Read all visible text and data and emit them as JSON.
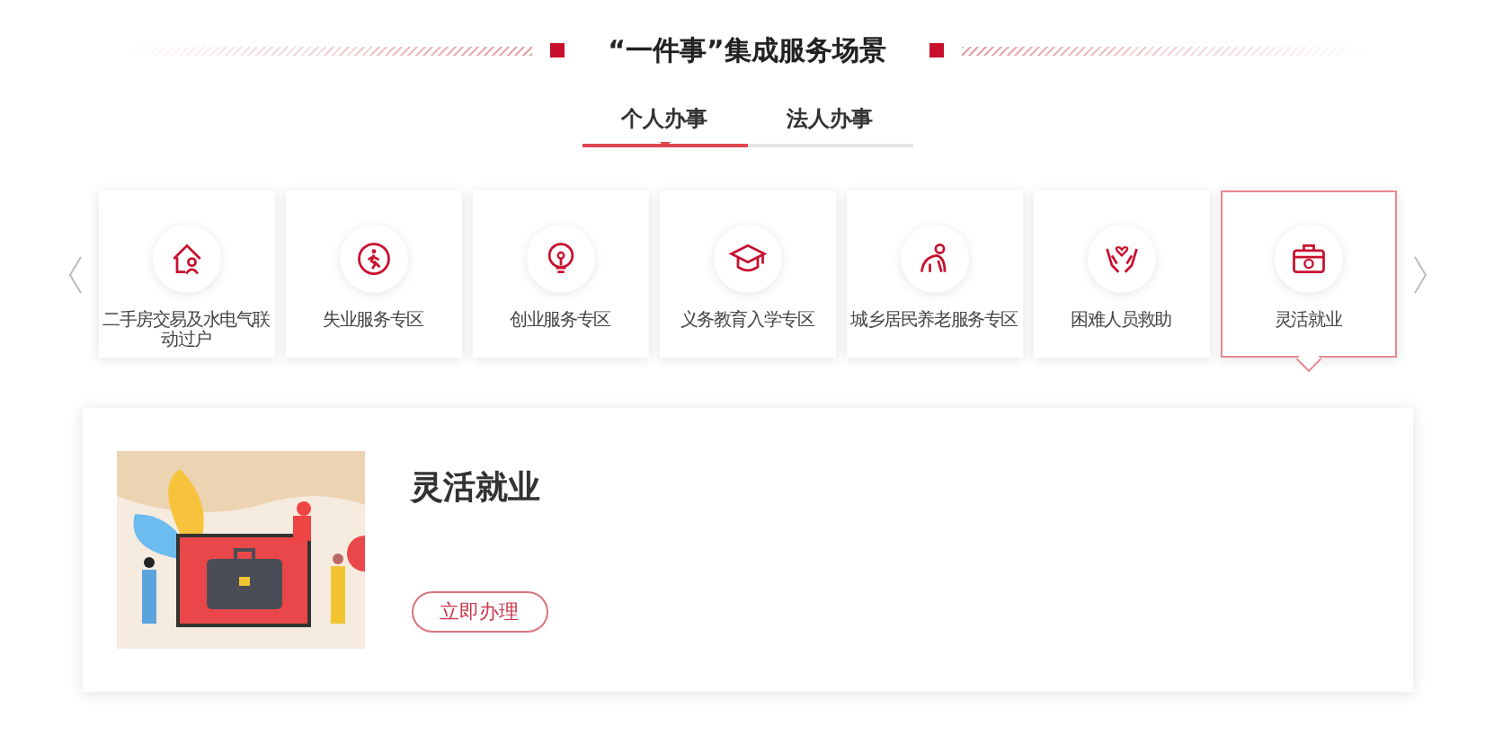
{
  "heading": "“一件事”集成服务场景",
  "tabs": [
    {
      "label": "个人办事",
      "selected": true
    },
    {
      "label": "法人办事",
      "selected": false
    }
  ],
  "scenarios": [
    {
      "label": "二手房交易及水电气联动过户",
      "selected": false
    },
    {
      "label": "失业服务专区",
      "selected": false
    },
    {
      "label": "创业服务专区",
      "selected": false
    },
    {
      "label": "义务教育入学专区",
      "selected": false
    },
    {
      "label": "城乡居民养老服务专区",
      "selected": false
    },
    {
      "label": "困难人员救助",
      "selected": false
    },
    {
      "label": "灵活就业",
      "selected": true
    }
  ],
  "detail": {
    "title": "灵活就业",
    "button": "立即办理"
  }
}
